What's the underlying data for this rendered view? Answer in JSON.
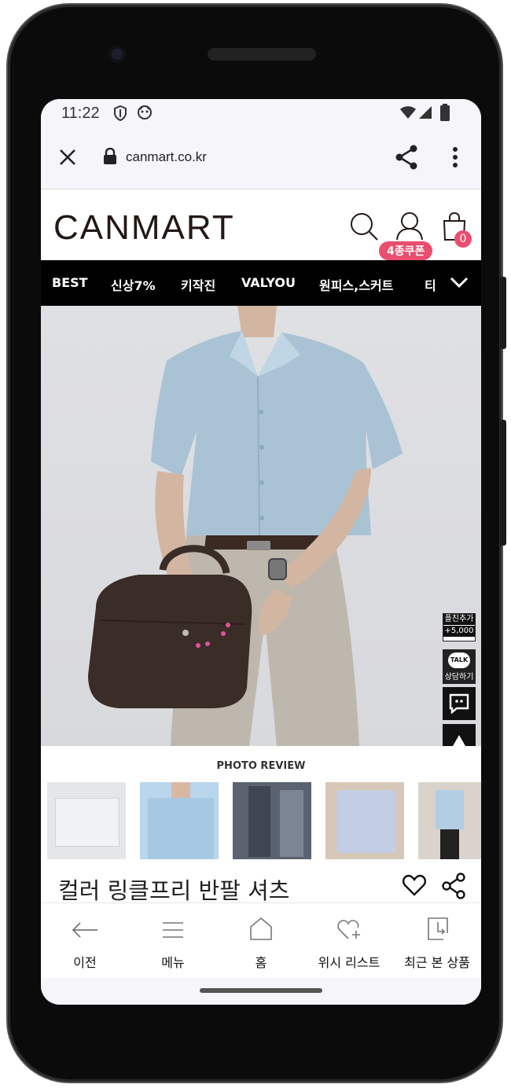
{
  "status": {
    "time": "11:22"
  },
  "browser": {
    "url": "canmart.co.kr"
  },
  "site": {
    "logo": "CANMART",
    "coupon_badge": "4종쿠폰",
    "cart_count": "0"
  },
  "categories": [
    "BEST",
    "신상7%",
    "키작진",
    "VALYOU",
    "원피스,스커트",
    "티"
  ],
  "review": {
    "title": "PHOTO REVIEW"
  },
  "product": {
    "title": "컬러 링클프리 반팔 셔츠"
  },
  "float": {
    "plusfriend_top": "플친추가",
    "plusfriend_bottom": "+5,000",
    "talk_label": "TALK",
    "talk_caption": "상담하기"
  },
  "bottom_nav": [
    "이전",
    "메뉴",
    "홈",
    "위시 리스트",
    "최근 본 상품"
  ],
  "colors": {
    "accent": "#e94e6e",
    "nav_bg": "#000000",
    "shirt": "#a9c3d5"
  }
}
